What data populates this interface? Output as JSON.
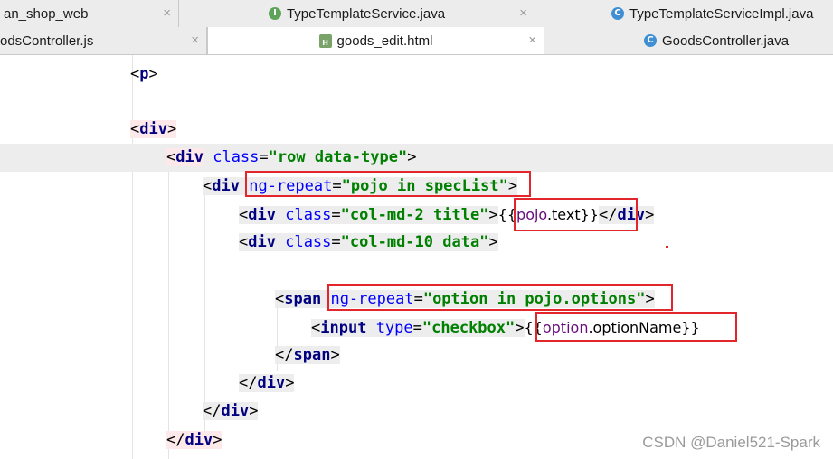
{
  "tabs_row1": [
    {
      "label": "an_shop_web",
      "icon": "none",
      "active": false
    },
    {
      "label": "TypeTemplateService.java",
      "icon": "interface-icon",
      "active": false
    },
    {
      "label": "TypeTemplateServiceImpl.java",
      "icon": "class-icon",
      "active": false
    }
  ],
  "tabs_row2": [
    {
      "label": "odsController.js",
      "icon": "none",
      "active": false
    },
    {
      "label": "goods_edit.html",
      "icon": "html-file-icon",
      "active": true
    },
    {
      "label": "GoodsController.java",
      "icon": "class-icon",
      "active": false
    }
  ],
  "close_glyph": "×",
  "code": {
    "l1_open": "<",
    "l1_tag": "p",
    "l1_close": ">",
    "l2_open": "<",
    "l2_tag": "div",
    "l2_close": ">",
    "l3_tag": "div",
    "l3_attr": "class",
    "l3_val": "\"row data-type\"",
    "l4_tag": "div",
    "l4_attr": "ng-repeat",
    "l4_val": "\"pojo in specList\"",
    "l5_tag": "div",
    "l5_attr": "class",
    "l5_val": "\"col-md-2 title\"",
    "l5_expr_a": "{{",
    "l5_expr_obj": "pojo",
    "l5_expr_b": ".text}}",
    "l5_end": "div",
    "l6_tag": "div",
    "l6_attr": "class",
    "l6_val": "\"col-md-10 data\"",
    "l7_tag": "span",
    "l7_attr": "ng-repeat",
    "l7_val": "\"option in pojo.options\"",
    "l8_tag": "input",
    "l8_attr": "type",
    "l8_val": "\"checkbox\"",
    "l8_expr_a": "{{",
    "l8_expr_obj": "option",
    "l8_expr_b": ".optionName}}",
    "l9_tag": "span",
    "l10_tag": "div",
    "l11_tag": "div",
    "l12_tag": "div"
  },
  "watermark": "CSDN @Daniel521-Spark",
  "colors": {
    "highlight_box": "#e2262b",
    "tag": "#000080",
    "attr": "#0000ff",
    "string": "#008000"
  }
}
